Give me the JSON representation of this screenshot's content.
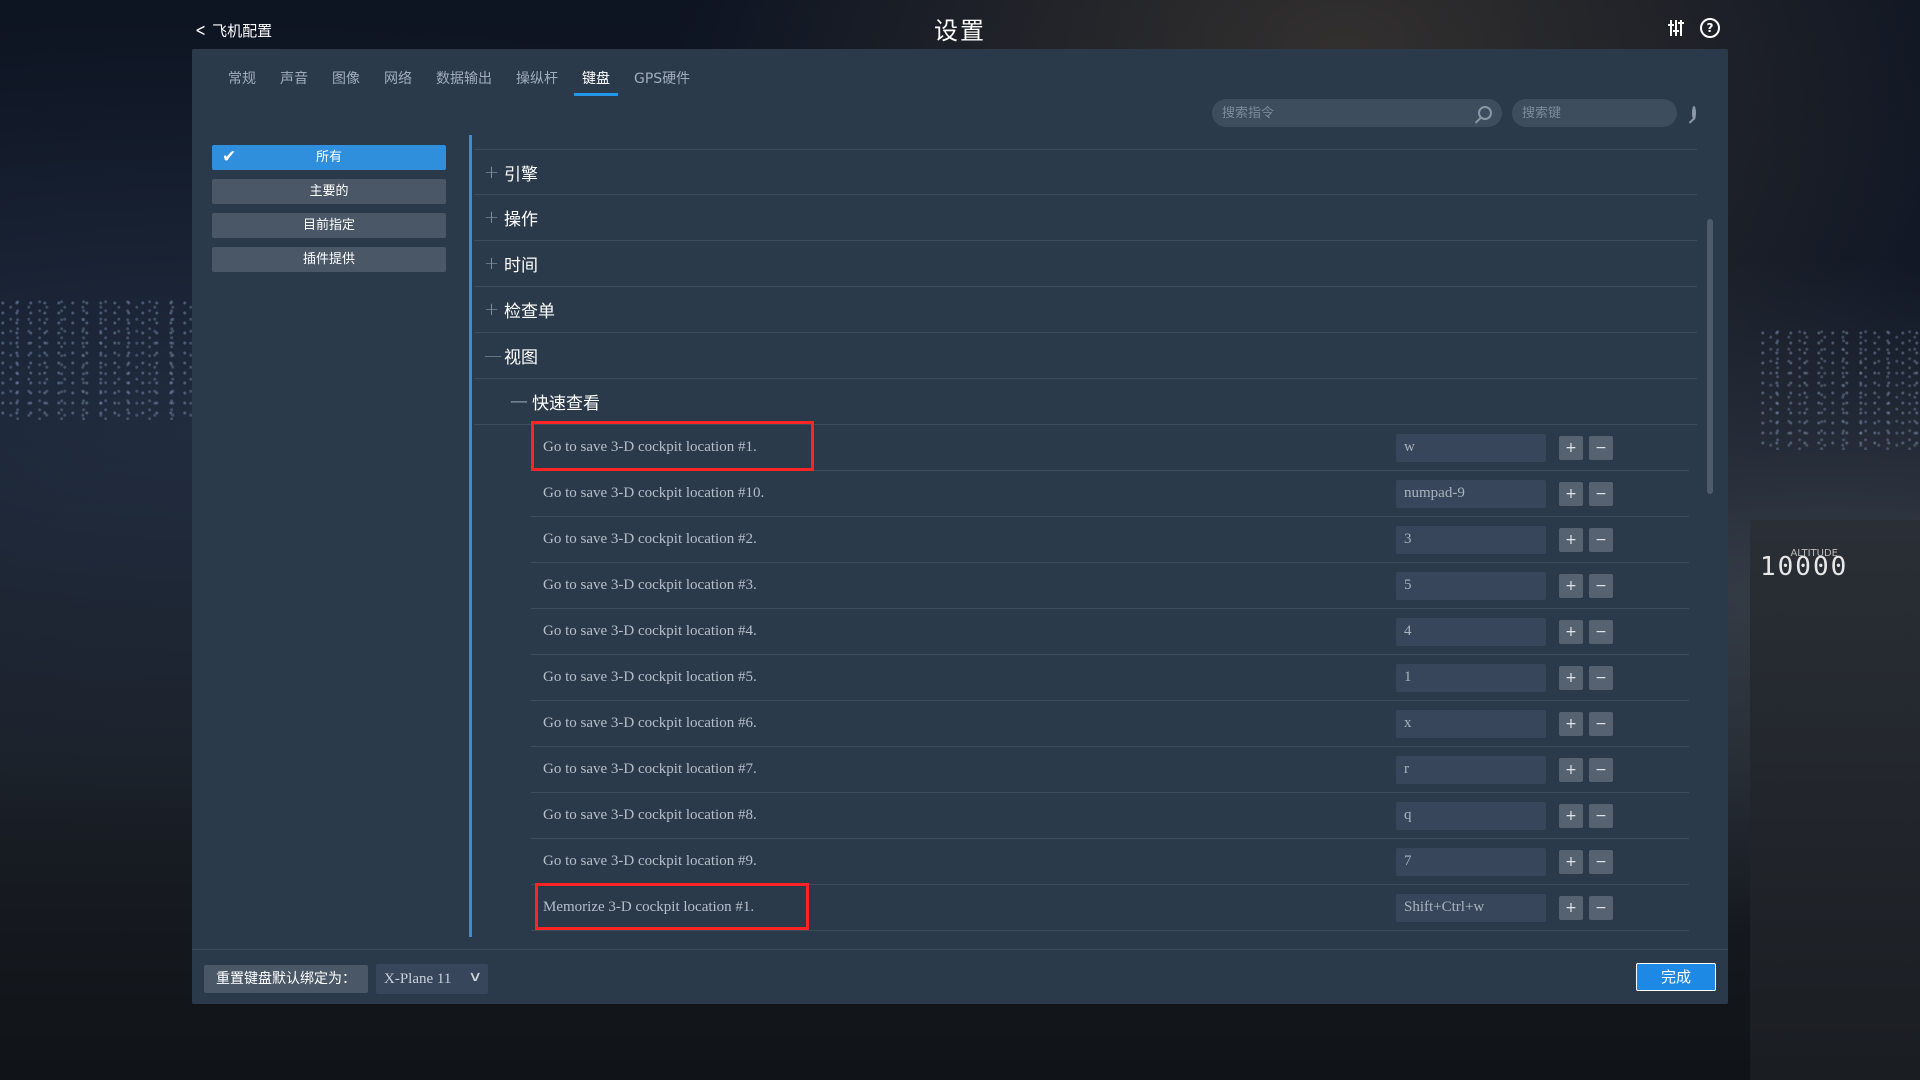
{
  "header": {
    "back_label": "飞机配置",
    "title": "设置",
    "icons": [
      "sliders-icon",
      "help-icon"
    ]
  },
  "tabs": [
    {
      "label": "常规"
    },
    {
      "label": "声音"
    },
    {
      "label": "图像"
    },
    {
      "label": "网络"
    },
    {
      "label": "数据输出"
    },
    {
      "label": "操纵杆"
    },
    {
      "label": "键盘",
      "active": true
    },
    {
      "label": "GPS硬件"
    }
  ],
  "search": {
    "command_placeholder": "搜索指令",
    "key_placeholder": "搜索键"
  },
  "filters": [
    {
      "label": "所有",
      "active": true
    },
    {
      "label": "主要的"
    },
    {
      "label": "目前指定"
    },
    {
      "label": "插件提供"
    }
  ],
  "categories": [
    {
      "sign": "+",
      "label": "引擎"
    },
    {
      "sign": "+",
      "label": "操作"
    },
    {
      "sign": "+",
      "label": "时间"
    },
    {
      "sign": "+",
      "label": "检查单"
    },
    {
      "sign": "—",
      "label": "视图"
    }
  ],
  "subcategory": {
    "sign": "—",
    "label": "快速查看"
  },
  "rows": [
    {
      "label": "Go to save 3-D cockpit location #1.",
      "key": "w",
      "highlighted": true
    },
    {
      "label": "Go to save 3-D cockpit location #10.",
      "key": "numpad-9"
    },
    {
      "label": "Go to save 3-D cockpit location #2.",
      "key": "3"
    },
    {
      "label": "Go to save 3-D cockpit location #3.",
      "key": "5"
    },
    {
      "label": "Go to save 3-D cockpit location #4.",
      "key": "4"
    },
    {
      "label": "Go to save 3-D cockpit location #5.",
      "key": "1"
    },
    {
      "label": "Go to save 3-D cockpit location #6.",
      "key": "x"
    },
    {
      "label": "Go to save 3-D cockpit location #7.",
      "key": "r"
    },
    {
      "label": "Go to save 3-D cockpit location #8.",
      "key": "q"
    },
    {
      "label": "Go to save 3-D cockpit location #9.",
      "key": "7"
    },
    {
      "label": "Memorize 3-D cockpit location #1.",
      "key": "Shift+Ctrl+w",
      "highlighted": true
    }
  ],
  "row_buttons": {
    "plus": "+",
    "minus": "−"
  },
  "footer": {
    "reset_label": "重置键盘默认绑定为：",
    "preset_value": "X-Plane 11",
    "done_label": "完成"
  },
  "background": {
    "altitude": "10000",
    "altitude_label": "ALTITUDE"
  },
  "colors": {
    "accent": "#2f8fdc",
    "highlight": "#ff2424",
    "panel": "#2b3a4a"
  }
}
